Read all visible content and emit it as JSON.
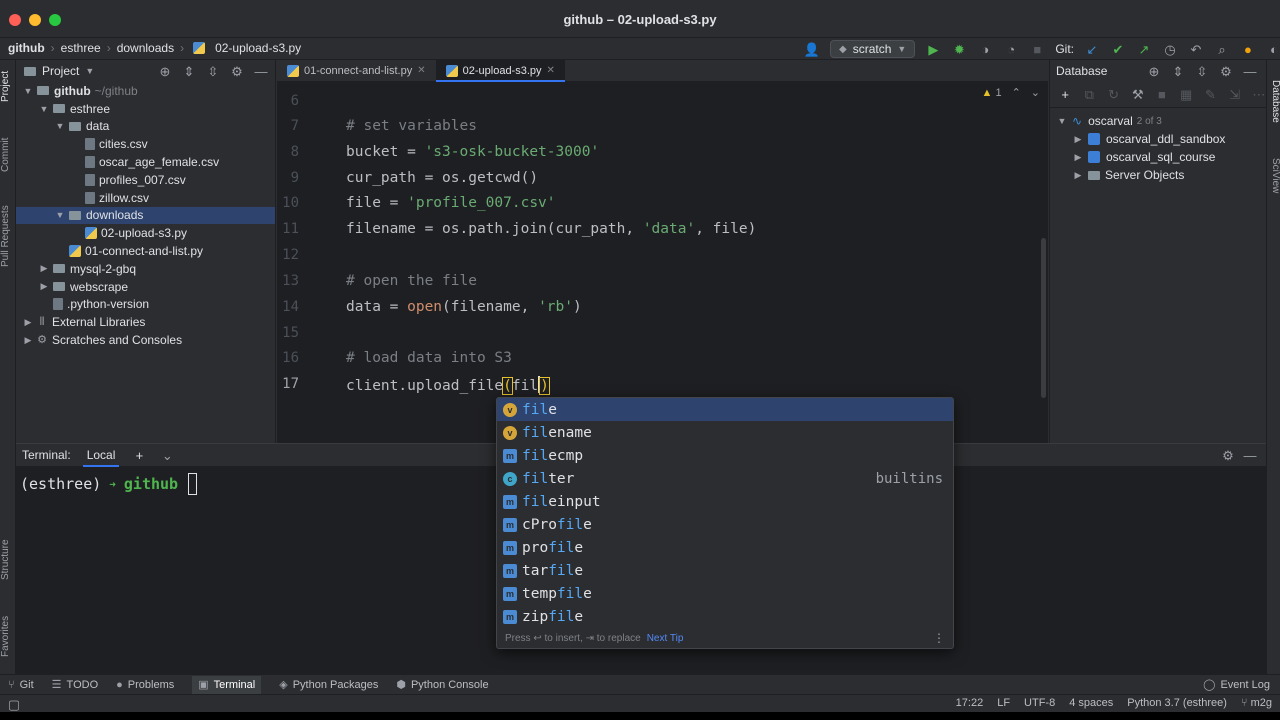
{
  "window": {
    "title": "github – 02-upload-s3.py"
  },
  "breadcrumbs": [
    "github",
    "esthree",
    "downloads",
    "02-upload-s3.py"
  ],
  "toolbar": {
    "run_config": "scratch",
    "git_label": "Git:"
  },
  "left_tabs": [
    "Project",
    "Commit",
    "Pull Requests",
    "Structure",
    "Favorites"
  ],
  "right_tabs": [
    "Database",
    "SciView"
  ],
  "project": {
    "title": "Project",
    "tree": [
      {
        "label": "github",
        "extra": "~/github",
        "type": "folder",
        "depth": 0,
        "open": true
      },
      {
        "label": "esthree",
        "type": "folder",
        "depth": 1,
        "open": true
      },
      {
        "label": "data",
        "type": "folder",
        "depth": 2,
        "open": true
      },
      {
        "label": "cities.csv",
        "type": "file",
        "depth": 3
      },
      {
        "label": "oscar_age_female.csv",
        "type": "file",
        "depth": 3
      },
      {
        "label": "profiles_007.csv",
        "type": "file",
        "depth": 3
      },
      {
        "label": "zillow.csv",
        "type": "file",
        "depth": 3
      },
      {
        "label": "downloads",
        "type": "folder",
        "depth": 2,
        "open": true,
        "selected": true
      },
      {
        "label": "02-upload-s3.py",
        "type": "py",
        "depth": 3
      },
      {
        "label": "01-connect-and-list.py",
        "type": "py",
        "depth": 2
      },
      {
        "label": "mysql-2-gbq",
        "type": "folder",
        "depth": 1,
        "open": false
      },
      {
        "label": "webscrape",
        "type": "folder",
        "depth": 1,
        "open": false
      },
      {
        "label": ".python-version",
        "type": "file",
        "depth": 1
      },
      {
        "label": "External Libraries",
        "type": "lib",
        "depth": 0,
        "open": false
      },
      {
        "label": "Scratches and Consoles",
        "type": "lib",
        "depth": 0,
        "open": false
      }
    ]
  },
  "editor": {
    "tabs": [
      {
        "label": "01-connect-and-list.py",
        "active": false
      },
      {
        "label": "02-upload-s3.py",
        "active": true
      }
    ],
    "warnings": "1",
    "line_numbers": [
      "6",
      "7",
      "8",
      "9",
      "10",
      "11",
      "12",
      "13",
      "14",
      "15",
      "16",
      "17"
    ],
    "current_line": "17",
    "lines": {
      "l7_comment": "# set variables",
      "l8_var": "bucket = ",
      "l8_str": "'s3-osk-bucket-3000'",
      "l9": "cur_path = os.getcwd()",
      "l10_var": "file = ",
      "l10_str": "'profile_007.csv'",
      "l11_pre": "filename = os.path.join(cur_path, ",
      "l11_str": "'data'",
      "l11_post": ", file)",
      "l13_comment": "# open the file",
      "l14_pre": "data = ",
      "l14_fn": "open",
      "l14_mid": "(filename, ",
      "l14_str": "'rb'",
      "l14_post": ")",
      "l16_comment": "# load data into S3",
      "l17_pre": "client.upload_file",
      "l17_paren": "(",
      "l17_typed": "fil",
      "l17_close": ")"
    }
  },
  "completion": {
    "items": [
      {
        "icon": "v",
        "color": "#d6a53a",
        "pre": "",
        "match": "fil",
        "post": "e",
        "tail": ""
      },
      {
        "icon": "v",
        "color": "#d6a53a",
        "pre": "",
        "match": "fil",
        "post": "ename",
        "tail": ""
      },
      {
        "icon": "m",
        "color": "#4a8bd3",
        "pre": "",
        "match": "fil",
        "post": "ecmp",
        "tail": ""
      },
      {
        "icon": "c",
        "color": "#3fa6c9",
        "pre": "",
        "match": "fil",
        "post": "ter",
        "tail": "builtins"
      },
      {
        "icon": "m",
        "color": "#4a8bd3",
        "pre": "",
        "match": "fil",
        "post": "einput",
        "tail": ""
      },
      {
        "icon": "m",
        "color": "#4a8bd3",
        "pre": "cPro",
        "match": "fil",
        "post": "e",
        "tail": ""
      },
      {
        "icon": "m",
        "color": "#4a8bd3",
        "pre": "pro",
        "match": "fil",
        "post": "e",
        "tail": ""
      },
      {
        "icon": "m",
        "color": "#4a8bd3",
        "pre": "tar",
        "match": "fil",
        "post": "e",
        "tail": ""
      },
      {
        "icon": "m",
        "color": "#4a8bd3",
        "pre": "temp",
        "match": "fil",
        "post": "e",
        "tail": ""
      },
      {
        "icon": "m",
        "color": "#4a8bd3",
        "pre": "zip",
        "match": "fil",
        "post": "e",
        "tail": ""
      }
    ],
    "footer": "Press ↩ to insert, ⇥ to replace",
    "next_tip": "Next Tip"
  },
  "database": {
    "title": "Database",
    "root": "oscarval",
    "root_count": "2 of 3",
    "items": [
      "oscarval_ddl_sandbox",
      "oscarval_sql_course",
      "Server Objects"
    ]
  },
  "terminal": {
    "title": "Terminal:",
    "tab": "Local",
    "prompt_env": "(esthree)",
    "prompt_dir": "github"
  },
  "bottom_tools": [
    "Git",
    "TODO",
    "Problems",
    "Terminal",
    "Python Packages",
    "Python Console"
  ],
  "active_tool": "Terminal",
  "event_log": "Event Log",
  "status": {
    "position": "17:22",
    "line_sep": "LF",
    "encoding": "UTF-8",
    "indent": "4 spaces",
    "interpreter": "Python 3.7 (esthree)",
    "branch": "m2g"
  },
  "colors": {
    "accent": "#3574f0",
    "selection": "#2e436e",
    "string": "#6aab73",
    "comment": "#7a7e85"
  }
}
